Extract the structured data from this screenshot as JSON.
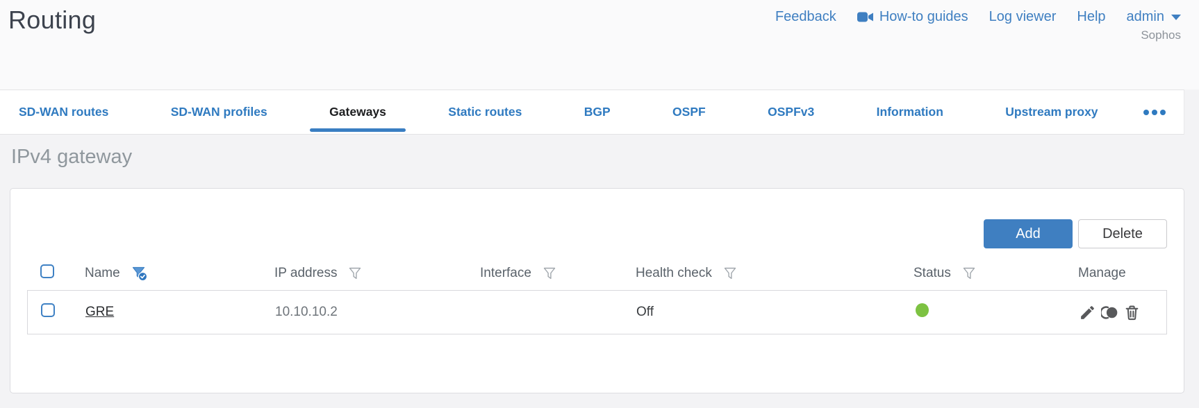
{
  "header": {
    "title": "Routing",
    "nav": {
      "feedback": "Feedback",
      "howto": "How-to guides",
      "log_viewer": "Log viewer",
      "help": "Help",
      "admin": "admin"
    },
    "account": "Sophos"
  },
  "tabs": {
    "items": [
      {
        "label": "SD-WAN routes",
        "active": false
      },
      {
        "label": "SD-WAN profiles",
        "active": false
      },
      {
        "label": "Gateways",
        "active": true
      },
      {
        "label": "Static routes",
        "active": false
      },
      {
        "label": "BGP",
        "active": false
      },
      {
        "label": "OSPF",
        "active": false
      },
      {
        "label": "OSPFv3",
        "active": false
      },
      {
        "label": "Information",
        "active": false
      },
      {
        "label": "Upstream proxy",
        "active": false
      }
    ],
    "overflow_icon": "ellipsis-icon"
  },
  "main": {
    "section_title": "IPv4 gateway",
    "toolbar": {
      "add_label": "Add",
      "delete_label": "Delete"
    },
    "table": {
      "columns": [
        {
          "label": "Name",
          "filter": "active"
        },
        {
          "label": "IP address",
          "filter": "inactive"
        },
        {
          "label": "Interface",
          "filter": "inactive"
        },
        {
          "label": "Health check",
          "filter": "inactive"
        },
        {
          "label": "Status",
          "filter": "inactive"
        },
        {
          "label": "Manage",
          "filter": "none"
        }
      ],
      "rows": [
        {
          "name": "GRE",
          "ip_address": "10.10.10.2",
          "interface": "",
          "health_check": "Off",
          "status": "up",
          "manage_icons": [
            "edit-icon",
            "clone-icon",
            "delete-icon"
          ]
        }
      ]
    }
  },
  "colors": {
    "accent_blue": "#3f7fc1",
    "tab_active_underline": "#3a7ec2",
    "status_green": "#7dc242",
    "icon_gray": "#58595b",
    "heading_gray": "#8f979d"
  }
}
